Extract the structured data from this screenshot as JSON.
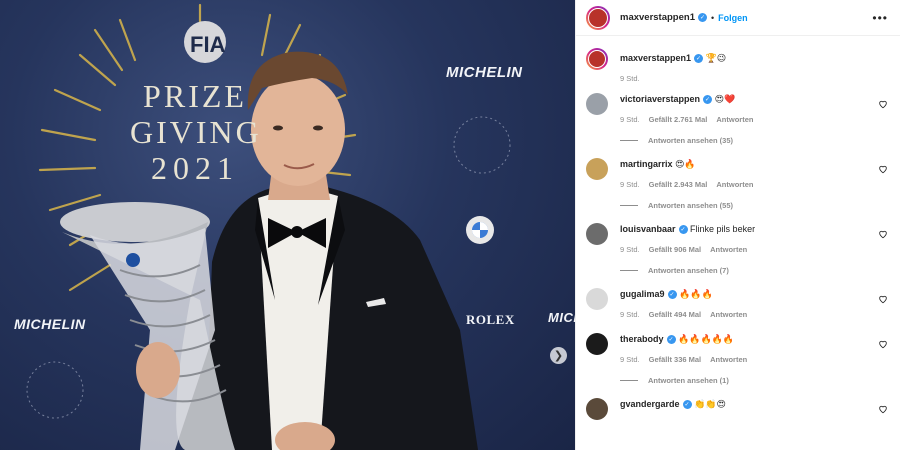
{
  "photo": {
    "event_title": [
      "PRIZE",
      "GIVING",
      "2021"
    ],
    "fia_logo": "FIA",
    "sponsors": {
      "michelin": "MICHELIN",
      "bmw": "BMW",
      "rolex": "ROLEX"
    },
    "nav_arrow": "❯"
  },
  "post": {
    "username": "maxverstappen1",
    "separator": "•",
    "follow_label": "Folgen",
    "more_label": "•••",
    "caption": "🏆😉",
    "time": "9 Std."
  },
  "comments": [
    {
      "user": "victoriaverstappen",
      "text": "😍❤️",
      "time": "9 Std.",
      "likes": "Gefällt 2.761 Mal",
      "reply": "Antworten",
      "replies": "Antworten ansehen (35)",
      "avatar_color": "#9aa0a8"
    },
    {
      "user": "martingarrix",
      "text": "😍🔥",
      "time": "9 Std.",
      "likes": "Gefällt 2.943 Mal",
      "reply": "Antworten",
      "replies": "Antworten ansehen (55)",
      "avatar_color": "#c8a15a"
    },
    {
      "user": "louisvanbaar",
      "text": "Flinke pils beker",
      "time": "9 Std.",
      "likes": "Gefällt 906 Mal",
      "reply": "Antworten",
      "replies": "Antworten ansehen (7)",
      "avatar_color": "#6c6c6c"
    },
    {
      "user": "gugalima9",
      "text": "🔥🔥🔥",
      "time": "9 Std.",
      "likes": "Gefällt 494 Mal",
      "reply": "Antworten",
      "replies": "",
      "avatar_color": "#d9d9d9"
    },
    {
      "user": "therabody",
      "text": "🔥🔥🔥🔥🔥",
      "time": "9 Std.",
      "likes": "Gefällt 336 Mal",
      "reply": "Antworten",
      "replies": "Antworten ansehen (1)",
      "avatar_color": "#1b1b1b"
    },
    {
      "user": "gvandergarde",
      "text": "👏👏😍",
      "time": "",
      "likes": "",
      "reply": "",
      "replies": "",
      "avatar_color": "#5a4a3a"
    }
  ],
  "colors": {
    "accent": "#0095f6",
    "verified": "#3897f0",
    "photo_bg": "#26355d"
  }
}
